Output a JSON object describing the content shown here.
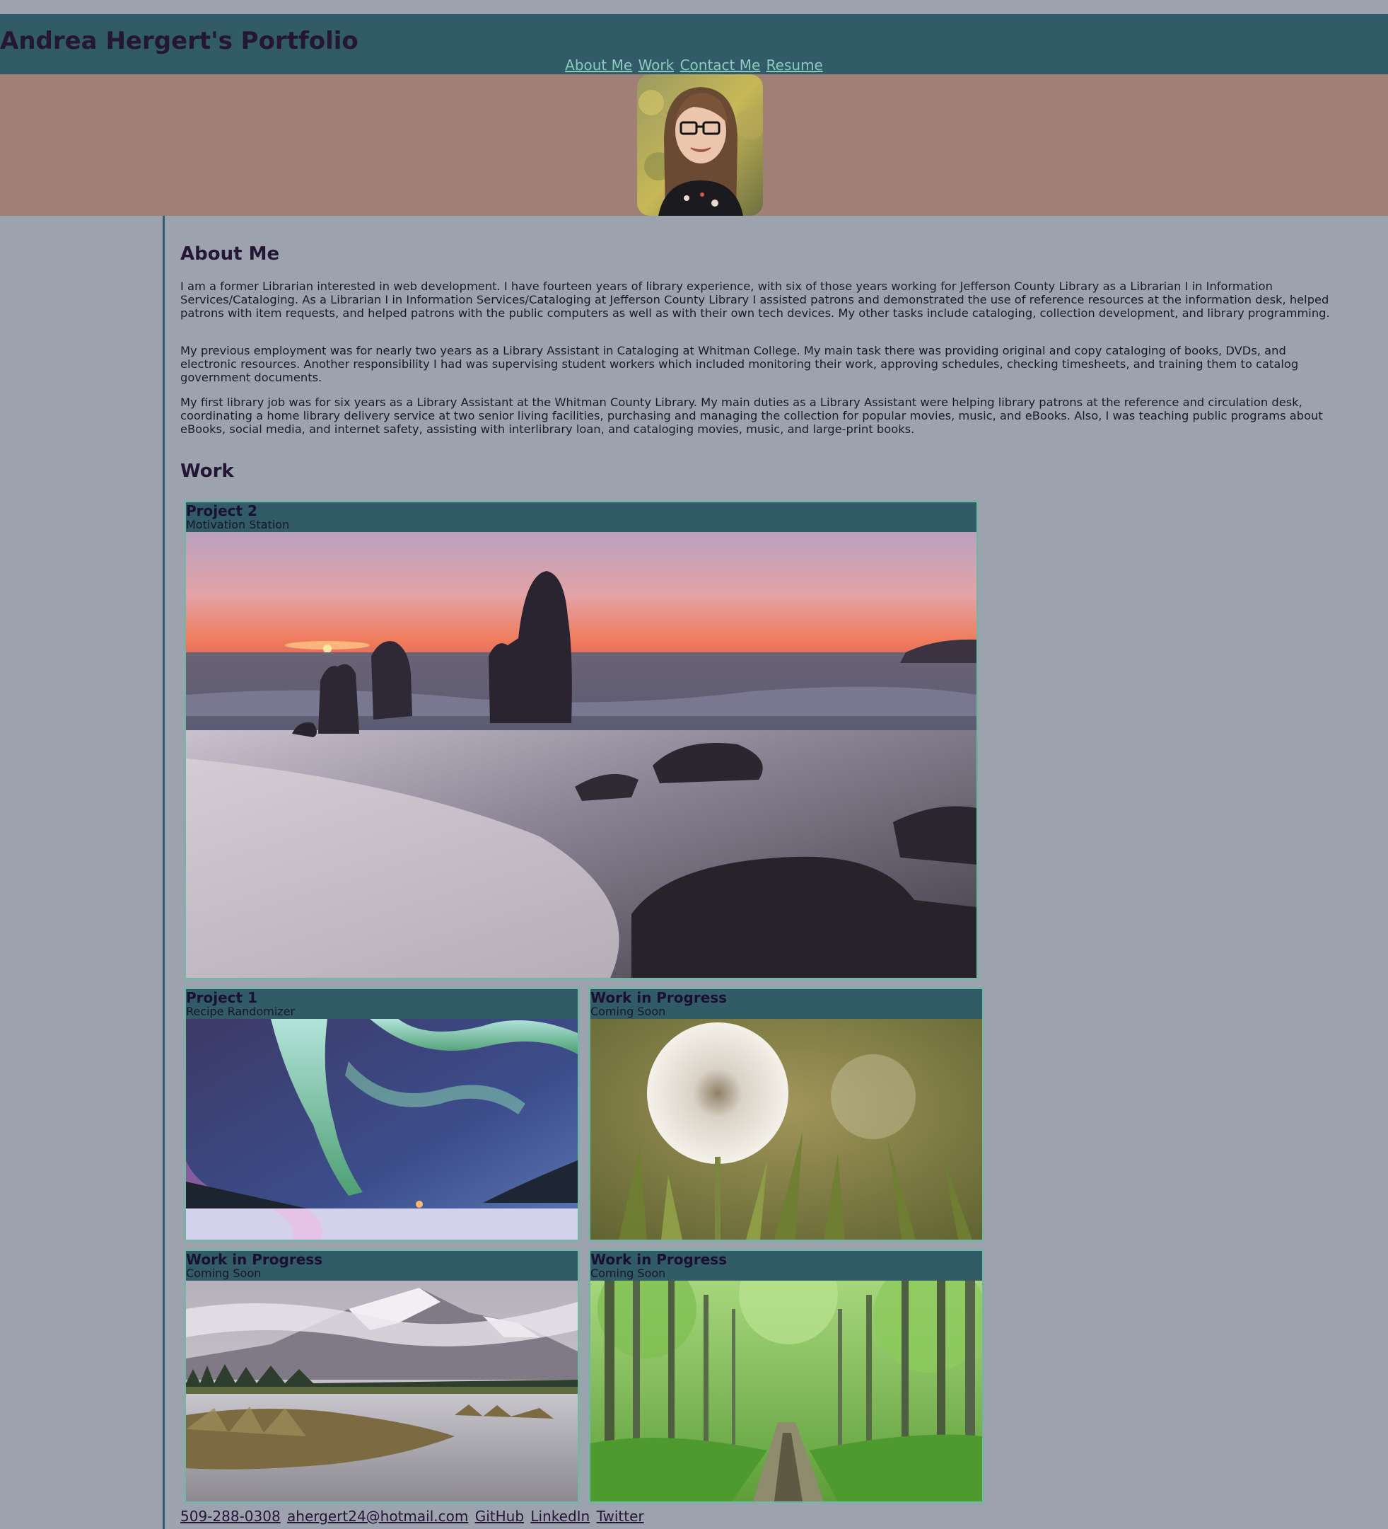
{
  "header": {
    "title": "Andrea Hergert's Portfolio",
    "nav": [
      "About Me",
      "Work",
      "Contact Me",
      "Resume"
    ]
  },
  "about": {
    "heading": "About Me",
    "paragraphs": [
      "I am a former Librarian interested in web development. I have fourteen years of library experience, with six of those years working for Jefferson County Library as a Librarian I in Information Services/Cataloging. As a Librarian I in Information Services/Cataloging at Jefferson County Library I assisted patrons and demonstrated the use of reference resources at the information desk, helped patrons with item requests, and helped patrons with the public computers as well as with their own tech devices. My other tasks include cataloging, collection development, and library programming.",
      "My previous employment was for nearly two years as a Library Assistant in Cataloging at Whitman College. My main task there was providing original and copy cataloging of books, DVDs, and electronic resources. Another responsibility I had was supervising student workers which included monitoring their work, approving schedules, checking timesheets, and training them to catalog government documents.",
      "My first library job was for six years as a Library Assistant at the Whitman County Library. My main duties as a Library Assistant were helping library patrons at the reference and circulation desk, coordinating a home library delivery service at two senior living facilities, purchasing and managing the collection for popular movies, music, and eBooks. Also, I was teaching public programs about eBooks, social media, and internet safety, assisting with interlibrary loan, and cataloging movies, music, and large-print books."
    ]
  },
  "work": {
    "heading": "Work",
    "projects": [
      {
        "title": "Project 2",
        "subtitle": "Motivation Station",
        "image": "sunset-beach-rocks"
      },
      {
        "title": "Project 1",
        "subtitle": "Recipe Randomizer",
        "image": "aurora-snowy-road"
      },
      {
        "title": "Work in Progress",
        "subtitle": "Coming Soon",
        "image": "dandelion-field"
      },
      {
        "title": "Work in Progress",
        "subtitle": "Coming Soon",
        "image": "mountain-lake"
      },
      {
        "title": "Work in Progress",
        "subtitle": "Coming Soon",
        "image": "forest-path"
      }
    ]
  },
  "footer": {
    "links": [
      "509-288-0308",
      "ahergert24@hotmail.com",
      "GitHub",
      "LinkedIn",
      "Twitter"
    ]
  },
  "colors": {
    "page_background": "#9ca3ae",
    "header_background": "#315b66",
    "banner_background": "#a08074",
    "nav_link": "#8cc9c0",
    "card_border": "#7bb2a6",
    "heading_text": "#241634"
  }
}
